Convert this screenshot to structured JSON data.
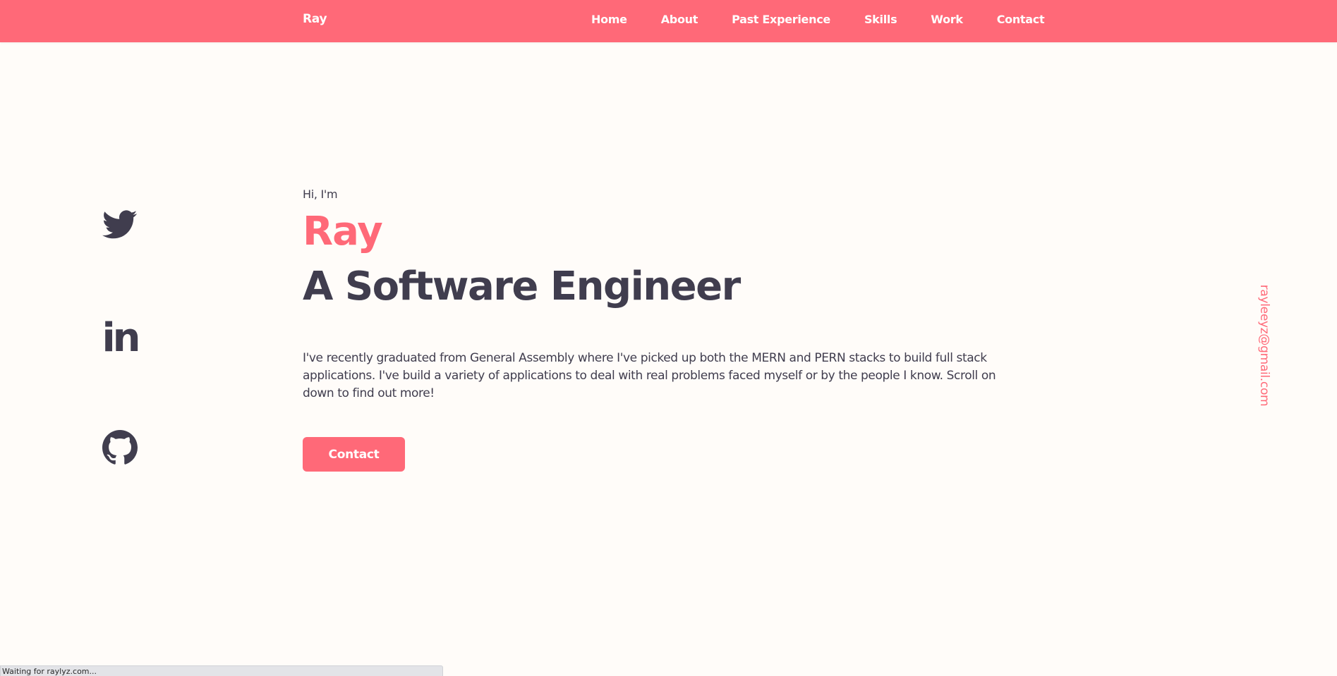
{
  "nav": {
    "brand": "Ray",
    "links": [
      "Home",
      "About",
      "Past Experience",
      "Skills",
      "Work",
      "Contact"
    ]
  },
  "social": {
    "icons": [
      "twitter-icon",
      "linkedin-icon",
      "github-icon"
    ],
    "linkedin_glyph": "in"
  },
  "hero": {
    "greeting": "Hi, I'm",
    "name": "Ray",
    "role": "A Software Engineer",
    "intro": "I've recently graduated from General Assembly where I've picked up both the MERN and PERN stacks to build full stack applications. I've build a variety of applications to deal with real problems faced myself or by the people I know. Scroll on down to find out more!",
    "contact_label": "Contact"
  },
  "email": "rayleeyz@gmail.com",
  "status_bar": "Waiting for raylyz.com...",
  "colors": {
    "accent": "#ff6978",
    "text": "#403d4e",
    "background": "#fffcf9"
  }
}
